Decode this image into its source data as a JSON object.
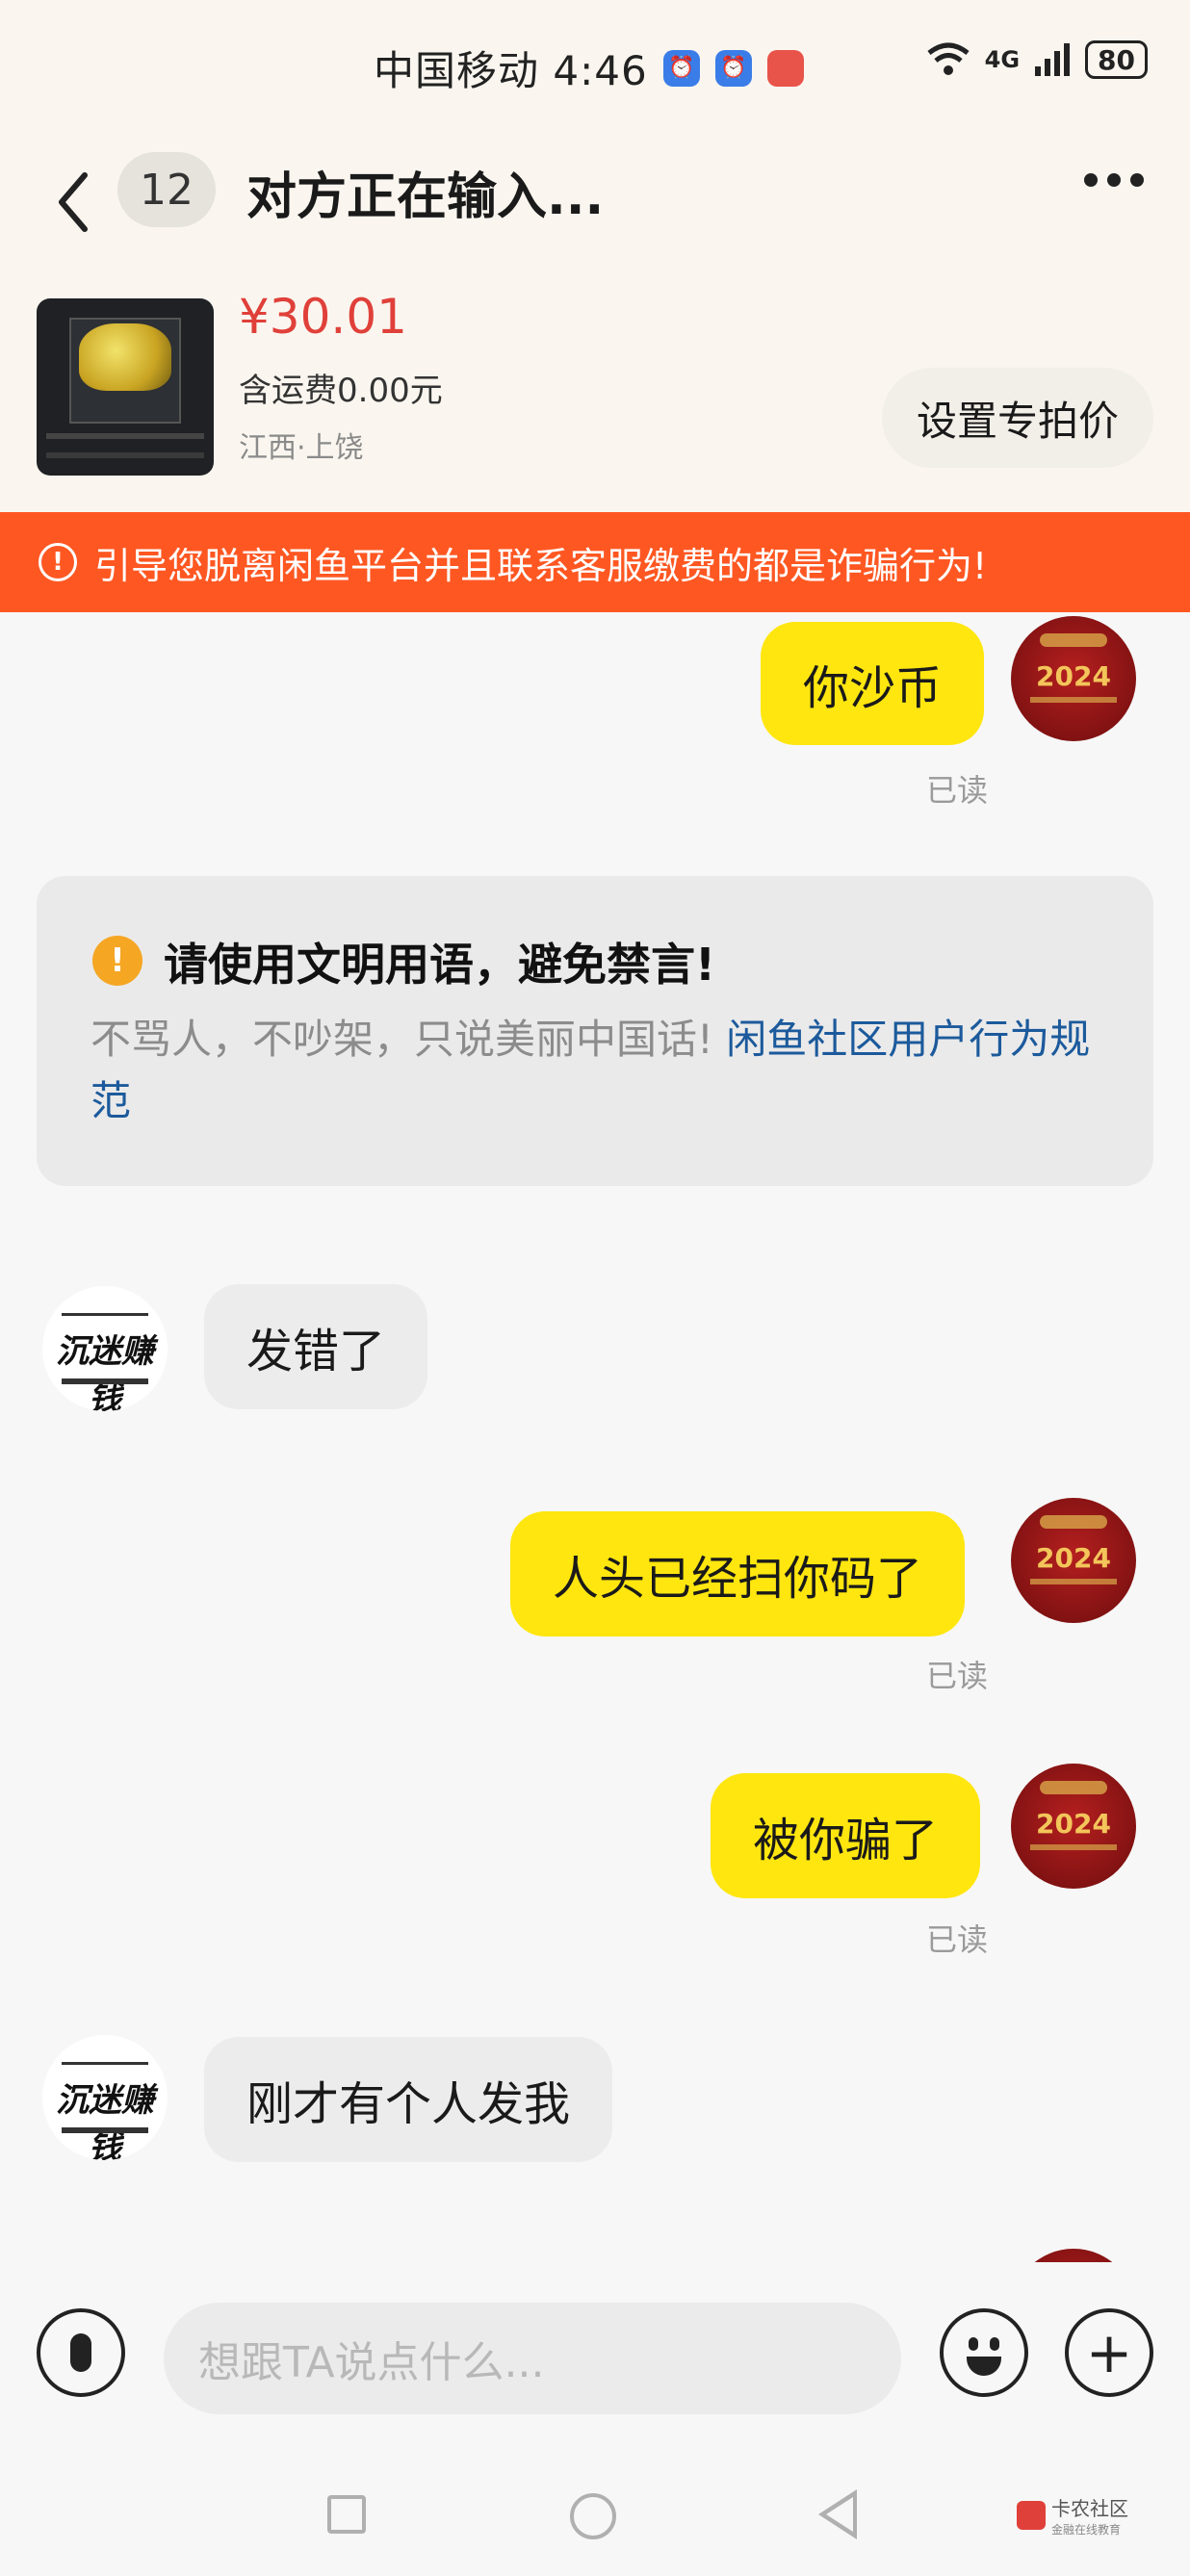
{
  "status_bar": {
    "carrier_time": "中国移动 4:46",
    "signal": "4G",
    "battery": "80"
  },
  "header": {
    "unread_count": "12",
    "title": "对方正在输入..."
  },
  "product": {
    "price": "¥30.01",
    "shipping": "含运费0.00元",
    "location": "江西·上饶",
    "set_price_button": "设置专拍价"
  },
  "banner": {
    "text": "引导您脱离闲鱼平台并且联系客服缴费的都是诈骗行为!"
  },
  "messages": {
    "m1": {
      "text": "你沙币",
      "status": "已读"
    },
    "notice": {
      "heading": "请使用文明用语，避免禁言!",
      "body": "不骂人，不吵架，只说美丽中国话!",
      "link": "闲鱼社区用户行为规范"
    },
    "m2": {
      "text": "发错了"
    },
    "m3": {
      "text": "人头已经扫你码了",
      "status": "已读"
    },
    "m4": {
      "text": "被你骗了",
      "status": "已读"
    },
    "m5": {
      "text": "刚才有个人发我"
    }
  },
  "avatars": {
    "me_year": "2024",
    "them_logo": "沉迷赚钱"
  },
  "input": {
    "placeholder": "想跟TA说点什么..."
  },
  "watermark": {
    "title": "卡农社区",
    "subtitle": "金融在线教育"
  }
}
